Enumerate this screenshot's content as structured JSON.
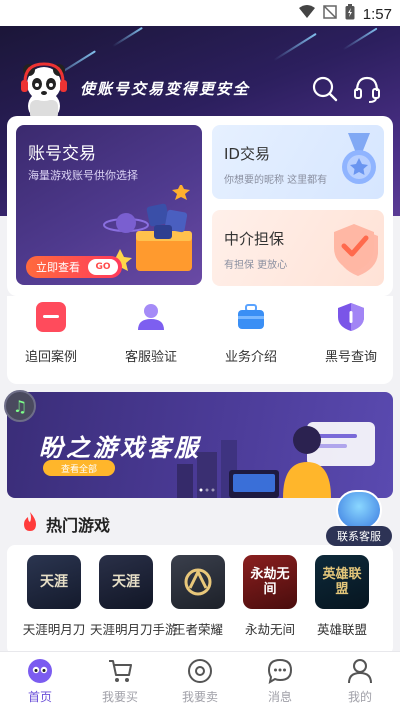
{
  "status_bar": {
    "time": "1:57"
  },
  "header": {
    "slogan": "使账号交易变得更安全",
    "icons": [
      "search-icon",
      "headset-icon"
    ]
  },
  "trade_cards": {
    "account": {
      "title": "账号交易",
      "subtitle": "海量游戏账号供你选择",
      "cta": "立即查看",
      "cta_badge": "GO"
    },
    "id_trade": {
      "title": "ID交易",
      "subtitle": "你想要的昵称 这里都有"
    },
    "guarantee": {
      "title": "中介担保",
      "subtitle": "有担保 更放心"
    }
  },
  "quick_menu": [
    {
      "label": "追回案例",
      "icon": "case-icon",
      "color": "#ff4b5c"
    },
    {
      "label": "客服验证",
      "icon": "user-verify-icon",
      "color": "#8a6df2"
    },
    {
      "label": "业务介绍",
      "icon": "briefcase-icon",
      "color": "#3a8ff5"
    },
    {
      "label": "黑号查询",
      "icon": "shield-icon",
      "color": "#7a55e8"
    }
  ],
  "banner": {
    "title": "盼之游戏客服",
    "button": "查看全部"
  },
  "hot_games": {
    "title": "热门游戏",
    "items": [
      {
        "label": "天涯明月刀",
        "icon_text": "天涯"
      },
      {
        "label": "天涯明月刀手游",
        "icon_text": "天涯"
      },
      {
        "label": "王者荣耀",
        "icon_text": ""
      },
      {
        "label": "永劫无间",
        "icon_text": "永劫无间"
      },
      {
        "label": "英雄联盟",
        "icon_text": "英雄联盟"
      }
    ]
  },
  "floating_service": {
    "label": "联系客服"
  },
  "bottom_nav": [
    {
      "label": "首页",
      "icon": "home-icon",
      "active": true
    },
    {
      "label": "我要买",
      "icon": "cart-icon",
      "active": false
    },
    {
      "label": "我要卖",
      "icon": "sell-icon",
      "active": false
    },
    {
      "label": "消息",
      "icon": "message-icon",
      "active": false
    },
    {
      "label": "我的",
      "icon": "profile-icon",
      "active": false
    }
  ]
}
